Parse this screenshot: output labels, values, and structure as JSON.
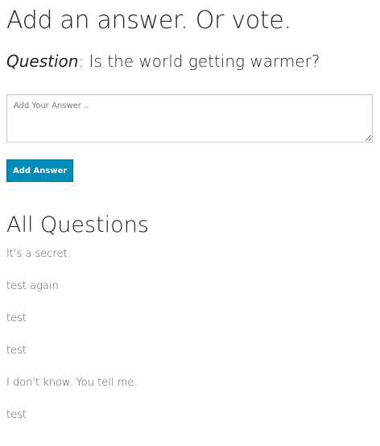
{
  "page": {
    "title": "Add an answer. Or vote.",
    "question_prefix": "Question",
    "question_text": ": Is the world getting warmer?"
  },
  "form": {
    "answer_placeholder": "Add Your Answer ..",
    "answer_value": "",
    "submit_label": "Add Answer",
    "button_color": "#008cba"
  },
  "questions_section": {
    "heading": "All Questions",
    "items": [
      "It's a secret.",
      "test again",
      "test",
      "test",
      "I don't know. You tell me.",
      "test"
    ]
  }
}
